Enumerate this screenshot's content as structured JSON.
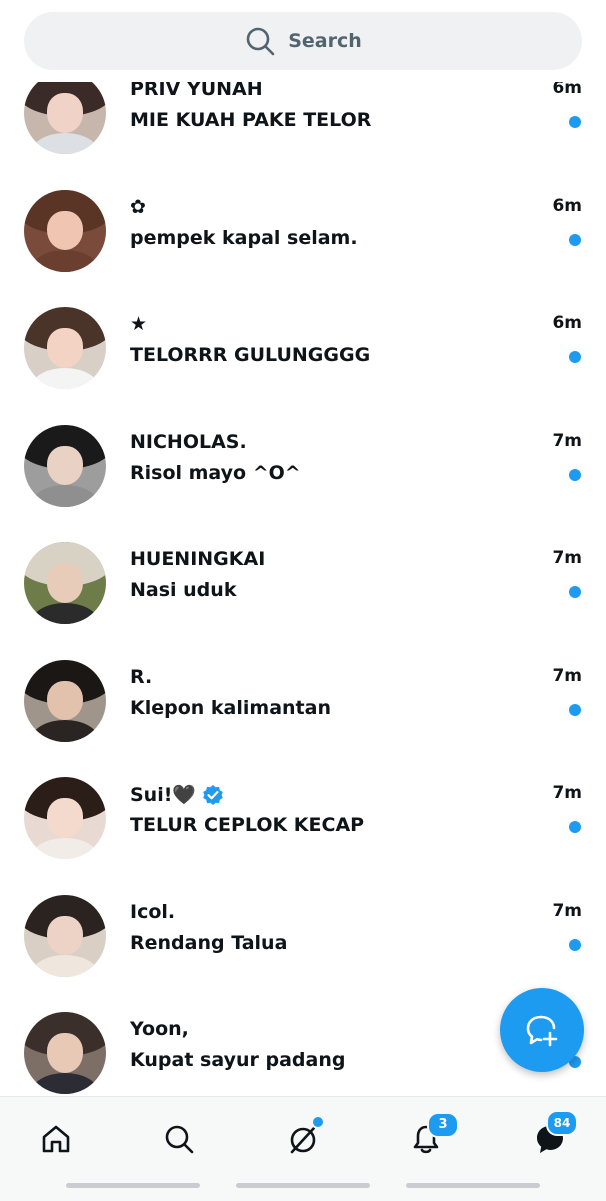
{
  "search": {
    "placeholder": "Search",
    "icon": "search-icon"
  },
  "conversations": [
    {
      "name": "PRIV YUNAH",
      "message": "MIE KUAH PAKE TELOR",
      "time": "6m",
      "unread": true,
      "avatar": {
        "hair": "#3a2a28",
        "face": "#f1d2c6",
        "body": "#dcdfe3",
        "bg": "#c7b6ac"
      }
    },
    {
      "name": "✿",
      "message": "pempek kapal selam.",
      "time": "6m",
      "unread": true,
      "avatar": {
        "hair": "#5a3526",
        "face": "#f0c6b2",
        "body": "#6b3f30",
        "bg": "#7a4a3a"
      }
    },
    {
      "name": "★",
      "message": "TELORRR GULUNGGGG",
      "time": "6m",
      "unread": true,
      "avatar": {
        "hair": "#4a3328",
        "face": "#f3d3c4",
        "body": "#f4f4f4",
        "bg": "#d8cfc7"
      }
    },
    {
      "name": "NICHOLAS.",
      "message": "Risol mayo ^O^",
      "time": "7m",
      "unread": true,
      "avatar": {
        "hair": "#1a1a1a",
        "face": "#e9d2c4",
        "body": "#8f8f8f",
        "bg": "#9d9d9d"
      }
    },
    {
      "name": "HUENINGKAI",
      "message": "Nasi uduk",
      "time": "7m",
      "unread": true,
      "avatar": {
        "hair": "#d8d2c4",
        "face": "#e7cdb9",
        "body": "#2b2b2b",
        "bg": "#6e7c4a"
      }
    },
    {
      "name": "R.",
      "message": "Klepon kalimantan",
      "time": "7m",
      "unread": true,
      "avatar": {
        "hair": "#1b1715",
        "face": "#e3c2ad",
        "body": "#2a2422",
        "bg": "#a0958a"
      }
    },
    {
      "name": "Sui!🖤",
      "verified": true,
      "message": "TELUR CEPLOK KECAP",
      "time": "7m",
      "unread": true,
      "avatar": {
        "hair": "#2b1d18",
        "face": "#f4d9cd",
        "body": "#f2ece8",
        "bg": "#e8d9d2"
      }
    },
    {
      "name": "Icol.",
      "message": "Rendang Talua",
      "time": "7m",
      "unread": true,
      "avatar": {
        "hair": "#2a2320",
        "face": "#ecd3c6",
        "body": "#efe6dd",
        "bg": "#d9cfc4"
      }
    },
    {
      "name": "Yoon,",
      "message": "Kupat sayur padang",
      "time": "",
      "unread": true,
      "avatar": {
        "hair": "#3a2f2a",
        "face": "#e8c9b5",
        "body": "#2c2c34",
        "bg": "#7d6e66"
      }
    }
  ],
  "fab": {
    "icon": "new-message-icon"
  },
  "bottom_nav": {
    "items": [
      "home-icon",
      "search-icon",
      "grok-icon",
      "bell-icon",
      "messages-icon"
    ],
    "notifications_badge": "3",
    "messages_badge": "84"
  },
  "colors": {
    "accent": "#1d9bf0",
    "text": "#0f1419",
    "muted": "#536471"
  }
}
